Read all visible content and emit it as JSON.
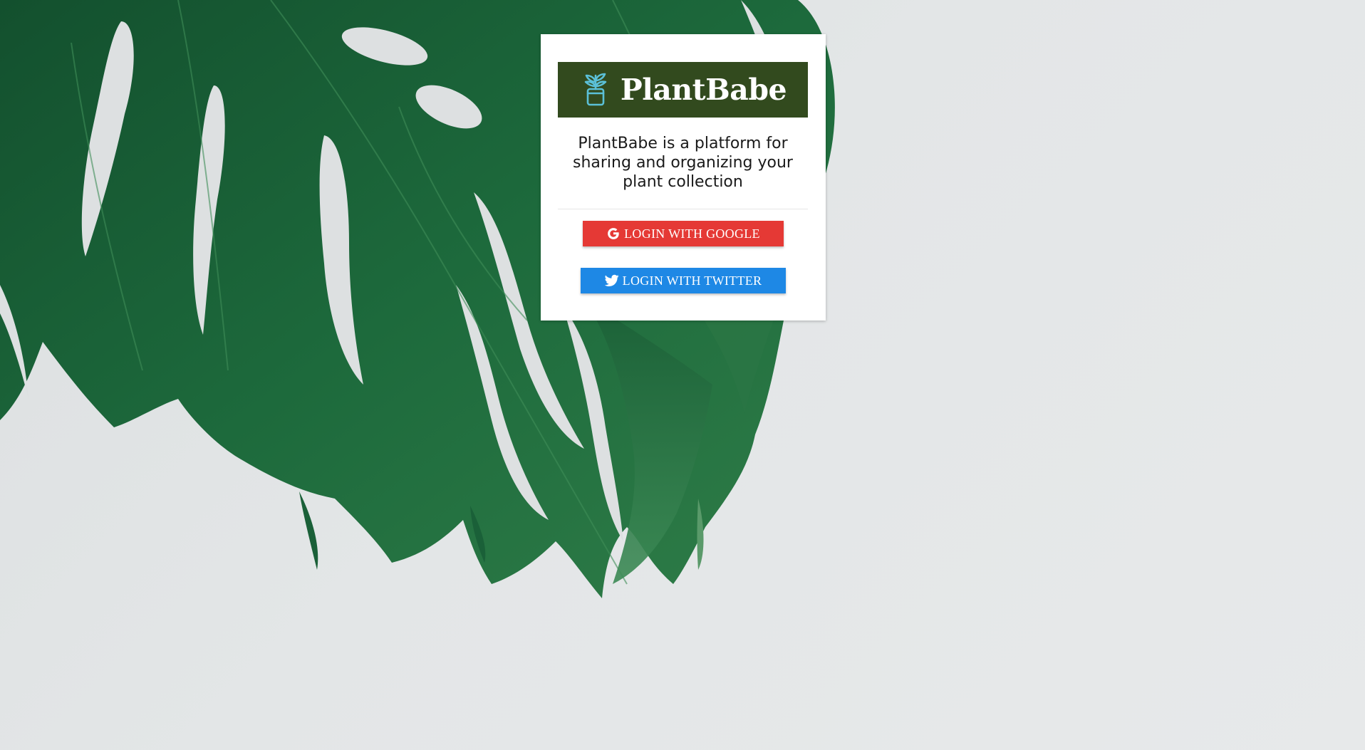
{
  "app": {
    "brand_name": "PlantBabe",
    "tagline": "PlantBabe is a platform for sharing and organizing your plant collection"
  },
  "auth": {
    "google_label": "LOGIN WITH GOOGLE",
    "twitter_label": "LOGIN WITH TWITTER"
  },
  "colors": {
    "banner": "#324a1e",
    "logo_icon": "#5bc0d8",
    "google": "#e53935",
    "twitter": "#1e88e5",
    "leaf": "#1e5a32"
  },
  "icons": {
    "logo": "potted-plant-icon",
    "google": "google-g-icon",
    "twitter": "twitter-bird-icon"
  }
}
